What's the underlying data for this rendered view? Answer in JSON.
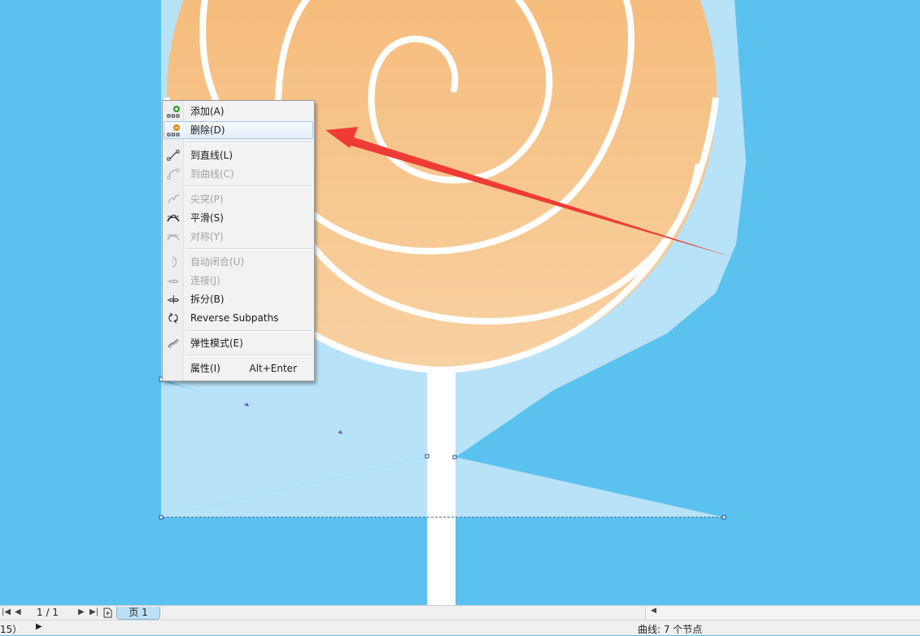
{
  "colors": {
    "background": "#5bc1ef",
    "cup": "#b7e2f8",
    "candy_top": "#f4b36a",
    "candy_bottom": "#f8d1a2",
    "stick": "#ffffff",
    "arrow": "#ef3b35"
  },
  "context_menu": {
    "items": [
      {
        "label": "添加(A)",
        "icon": "add-node-icon",
        "enabled": true
      },
      {
        "label": "删除(D)",
        "icon": "delete-node-icon",
        "enabled": true,
        "highlighted": true
      },
      {
        "label": "到直线(L)",
        "icon": "to-line-icon",
        "enabled": true
      },
      {
        "label": "到曲线(C)",
        "icon": "to-curve-icon",
        "enabled": false
      },
      {
        "label": "尖突(P)",
        "icon": "cusp-icon",
        "enabled": false
      },
      {
        "label": "平滑(S)",
        "icon": "smooth-icon",
        "enabled": true
      },
      {
        "label": "对称(Y)",
        "icon": "symmetrical-icon",
        "enabled": false
      },
      {
        "label": "自动闭合(U)",
        "icon": "auto-close-icon",
        "enabled": false
      },
      {
        "label": "连接(J)",
        "icon": "join-icon",
        "enabled": false
      },
      {
        "label": "拆分(B)",
        "icon": "break-icon",
        "enabled": true
      },
      {
        "label": "Reverse Subpaths",
        "icon": "reverse-subpaths-icon",
        "enabled": true
      },
      {
        "label": "弹性模式(E)",
        "icon": "elastic-mode-icon",
        "enabled": true
      },
      {
        "label": "属性(I)",
        "shortcut": "Alt+Enter",
        "enabled": true
      }
    ]
  },
  "page_nav": {
    "page_count": "1 / 1",
    "page_tab": "页 1"
  },
  "status": {
    "left": "15）",
    "right": "曲线: 7 个节点"
  }
}
